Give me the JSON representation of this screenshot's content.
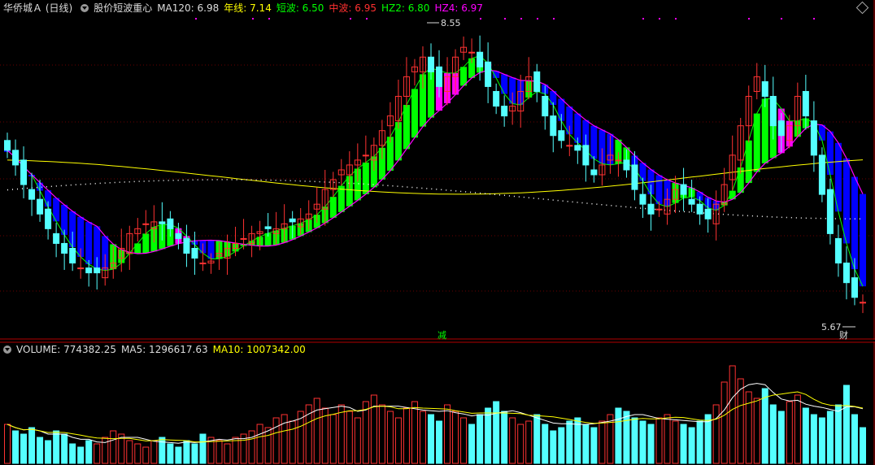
{
  "main_header": {
    "stock_name": "华侨城Ａ (日线)",
    "indicator_name": "股价短波重心",
    "ma120_label": "MA120: 6.98",
    "nianxian_label": "年线: 7.14",
    "duanbo_label": "短波: 6.50",
    "zhongbo_label": "中波: 6.95",
    "hz2_label": "HZ2: 6.80",
    "hz4_label": "HZ4: 6.97"
  },
  "volume_header": {
    "volume_label": "VOLUME: 774382.25",
    "ma5_label": "MA5: 1296617.63",
    "ma10_label": "MA10: 1007342.00"
  },
  "annotations": {
    "high_price": "8.55",
    "low_price": "5.67",
    "jian_mark": "减",
    "cai_mark": "财"
  },
  "colors": {
    "up": "#ff3232",
    "down": "#54ffff",
    "ma120": "#ffffff",
    "nianxian": "#ffff00",
    "duanbo": "#00ff00",
    "zhongbo": "#ff0000",
    "hz2": "#00ff00",
    "hz4": "#ff00ff",
    "ribbon_up": "#00ff00",
    "ribbon_down": "#0000ff",
    "ribbon_mid": "#ff00ff"
  },
  "chart_data": {
    "type": "candlestick",
    "price_axis": {
      "min": 5.5,
      "max": 8.7
    },
    "price_series": [
      7.35,
      7.2,
      7.0,
      6.85,
      6.7,
      6.55,
      6.4,
      6.3,
      6.2,
      6.15,
      6.1,
      6.1,
      6.15,
      6.2,
      6.35,
      6.5,
      6.55,
      6.6,
      6.62,
      6.6,
      6.55,
      6.45,
      6.3,
      6.25,
      6.2,
      6.22,
      6.3,
      6.35,
      6.4,
      6.45,
      6.5,
      6.52,
      6.55,
      6.55,
      6.6,
      6.62,
      6.65,
      6.7,
      6.8,
      6.95,
      7.05,
      7.15,
      7.2,
      7.25,
      7.3,
      7.4,
      7.55,
      7.7,
      7.9,
      8.1,
      8.2,
      8.3,
      8.15,
      8.0,
      8.1,
      8.3,
      8.4,
      8.35,
      8.2,
      8.0,
      7.8,
      7.7,
      7.8,
      7.95,
      8.1,
      7.95,
      7.7,
      7.5,
      7.45,
      7.4,
      7.35,
      7.2,
      7.1,
      7.2,
      7.3,
      7.25,
      7.15,
      6.95,
      6.8,
      6.7,
      6.75,
      6.85,
      6.95,
      6.9,
      6.8,
      6.7,
      6.65,
      6.8,
      7.0,
      7.3,
      7.6,
      7.9,
      8.1,
      7.9,
      7.6,
      7.5,
      7.6,
      7.9,
      7.7,
      7.3,
      6.9,
      6.5,
      6.2,
      6.0,
      5.85,
      5.8
    ],
    "volume_series": [
      1.2,
      1.0,
      0.9,
      1.1,
      0.8,
      0.7,
      1.0,
      0.9,
      0.6,
      0.5,
      0.7,
      0.6,
      0.8,
      1.0,
      0.9,
      0.7,
      0.6,
      0.5,
      0.7,
      0.8,
      0.6,
      0.5,
      0.7,
      0.6,
      0.9,
      0.8,
      0.7,
      0.6,
      0.8,
      0.9,
      1.0,
      1.2,
      1.1,
      1.4,
      1.5,
      1.3,
      1.6,
      1.8,
      2.0,
      1.7,
      1.5,
      1.8,
      1.6,
      1.4,
      1.9,
      2.1,
      1.8,
      1.6,
      1.4,
      1.7,
      1.9,
      1.6,
      1.5,
      1.3,
      1.8,
      1.6,
      1.4,
      1.2,
      1.5,
      1.7,
      1.9,
      1.6,
      1.4,
      1.2,
      1.3,
      1.5,
      1.2,
      1.0,
      1.1,
      1.3,
      1.4,
      1.2,
      1.1,
      1.3,
      1.5,
      1.7,
      1.6,
      1.4,
      1.3,
      1.2,
      1.4,
      1.5,
      1.3,
      1.2,
      1.1,
      1.3,
      1.5,
      1.8,
      2.5,
      3.0,
      2.6,
      2.2,
      2.0,
      2.3,
      1.8,
      1.6,
      1.9,
      2.1,
      1.7,
      1.5,
      1.4,
      1.6,
      1.8,
      2.4,
      1.5,
      1.1
    ]
  }
}
